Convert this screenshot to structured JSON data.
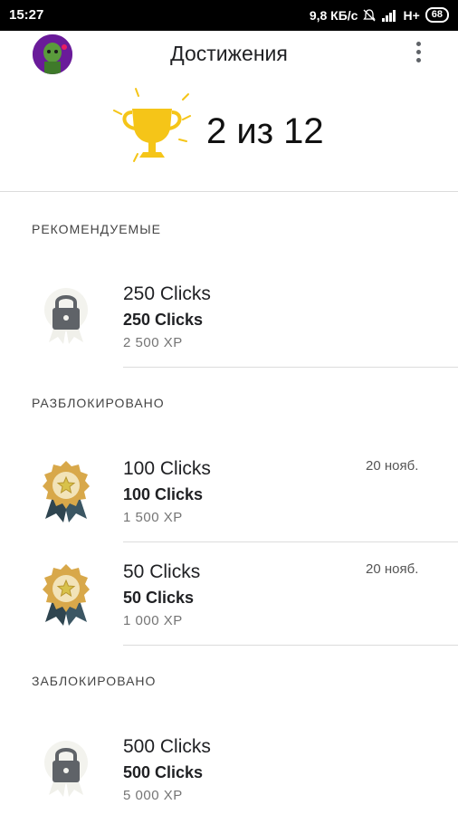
{
  "status": {
    "time": "15:27",
    "speed": "9,8 КБ/с",
    "network": "H+",
    "battery": "68"
  },
  "header": {
    "title": "Достижения"
  },
  "summary": {
    "count": "2 из 12"
  },
  "sections": {
    "recommended": {
      "label": "РЕКОМЕНДУЕМЫЕ",
      "items": [
        {
          "title": "250 Clicks",
          "subtitle": "250 Clicks",
          "xp": "2 500 XP"
        }
      ]
    },
    "unlocked": {
      "label": "РАЗБЛОКИРОВАНО",
      "items": [
        {
          "title": "100 Clicks",
          "subtitle": "100 Clicks",
          "xp": "1 500 XP",
          "date": "20 нояб."
        },
        {
          "title": "50 Clicks",
          "subtitle": "50 Clicks",
          "xp": "1 000 XP",
          "date": "20 нояб."
        }
      ]
    },
    "locked": {
      "label": "ЗАБЛОКИРОВАНО",
      "items": [
        {
          "title": "500 Clicks",
          "subtitle": "500 Clicks",
          "xp": "5 000 XP"
        }
      ]
    }
  },
  "colors": {
    "gold": "#f5c518",
    "medal_ribbon": "#2f4550",
    "lock": "#5f6368"
  }
}
